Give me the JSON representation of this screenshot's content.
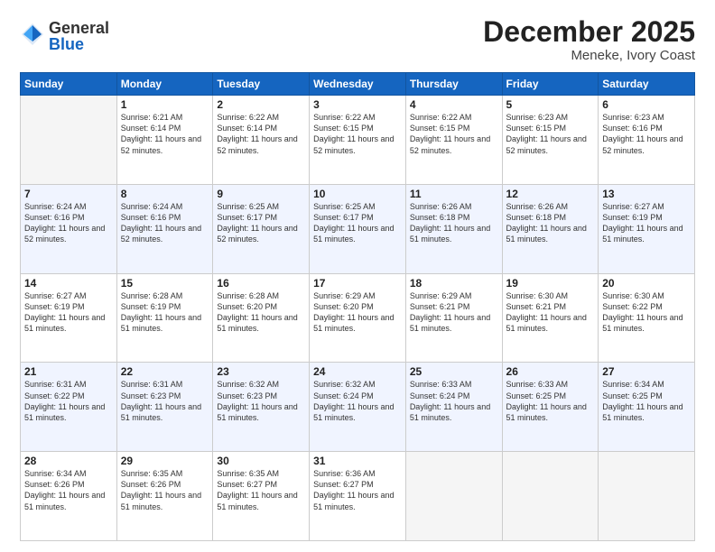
{
  "logo": {
    "general": "General",
    "blue": "Blue"
  },
  "title": "December 2025",
  "location": "Meneke, Ivory Coast",
  "days_header": [
    "Sunday",
    "Monday",
    "Tuesday",
    "Wednesday",
    "Thursday",
    "Friday",
    "Saturday"
  ],
  "weeks": [
    [
      {
        "num": "",
        "empty": true
      },
      {
        "num": "1",
        "sunrise": "Sunrise: 6:21 AM",
        "sunset": "Sunset: 6:14 PM",
        "daylight": "Daylight: 11 hours and 52 minutes."
      },
      {
        "num": "2",
        "sunrise": "Sunrise: 6:22 AM",
        "sunset": "Sunset: 6:14 PM",
        "daylight": "Daylight: 11 hours and 52 minutes."
      },
      {
        "num": "3",
        "sunrise": "Sunrise: 6:22 AM",
        "sunset": "Sunset: 6:15 PM",
        "daylight": "Daylight: 11 hours and 52 minutes."
      },
      {
        "num": "4",
        "sunrise": "Sunrise: 6:22 AM",
        "sunset": "Sunset: 6:15 PM",
        "daylight": "Daylight: 11 hours and 52 minutes."
      },
      {
        "num": "5",
        "sunrise": "Sunrise: 6:23 AM",
        "sunset": "Sunset: 6:15 PM",
        "daylight": "Daylight: 11 hours and 52 minutes."
      },
      {
        "num": "6",
        "sunrise": "Sunrise: 6:23 AM",
        "sunset": "Sunset: 6:16 PM",
        "daylight": "Daylight: 11 hours and 52 minutes."
      }
    ],
    [
      {
        "num": "7",
        "sunrise": "Sunrise: 6:24 AM",
        "sunset": "Sunset: 6:16 PM",
        "daylight": "Daylight: 11 hours and 52 minutes."
      },
      {
        "num": "8",
        "sunrise": "Sunrise: 6:24 AM",
        "sunset": "Sunset: 6:16 PM",
        "daylight": "Daylight: 11 hours and 52 minutes."
      },
      {
        "num": "9",
        "sunrise": "Sunrise: 6:25 AM",
        "sunset": "Sunset: 6:17 PM",
        "daylight": "Daylight: 11 hours and 52 minutes."
      },
      {
        "num": "10",
        "sunrise": "Sunrise: 6:25 AM",
        "sunset": "Sunset: 6:17 PM",
        "daylight": "Daylight: 11 hours and 51 minutes."
      },
      {
        "num": "11",
        "sunrise": "Sunrise: 6:26 AM",
        "sunset": "Sunset: 6:18 PM",
        "daylight": "Daylight: 11 hours and 51 minutes."
      },
      {
        "num": "12",
        "sunrise": "Sunrise: 6:26 AM",
        "sunset": "Sunset: 6:18 PM",
        "daylight": "Daylight: 11 hours and 51 minutes."
      },
      {
        "num": "13",
        "sunrise": "Sunrise: 6:27 AM",
        "sunset": "Sunset: 6:19 PM",
        "daylight": "Daylight: 11 hours and 51 minutes."
      }
    ],
    [
      {
        "num": "14",
        "sunrise": "Sunrise: 6:27 AM",
        "sunset": "Sunset: 6:19 PM",
        "daylight": "Daylight: 11 hours and 51 minutes."
      },
      {
        "num": "15",
        "sunrise": "Sunrise: 6:28 AM",
        "sunset": "Sunset: 6:19 PM",
        "daylight": "Daylight: 11 hours and 51 minutes."
      },
      {
        "num": "16",
        "sunrise": "Sunrise: 6:28 AM",
        "sunset": "Sunset: 6:20 PM",
        "daylight": "Daylight: 11 hours and 51 minutes."
      },
      {
        "num": "17",
        "sunrise": "Sunrise: 6:29 AM",
        "sunset": "Sunset: 6:20 PM",
        "daylight": "Daylight: 11 hours and 51 minutes."
      },
      {
        "num": "18",
        "sunrise": "Sunrise: 6:29 AM",
        "sunset": "Sunset: 6:21 PM",
        "daylight": "Daylight: 11 hours and 51 minutes."
      },
      {
        "num": "19",
        "sunrise": "Sunrise: 6:30 AM",
        "sunset": "Sunset: 6:21 PM",
        "daylight": "Daylight: 11 hours and 51 minutes."
      },
      {
        "num": "20",
        "sunrise": "Sunrise: 6:30 AM",
        "sunset": "Sunset: 6:22 PM",
        "daylight": "Daylight: 11 hours and 51 minutes."
      }
    ],
    [
      {
        "num": "21",
        "sunrise": "Sunrise: 6:31 AM",
        "sunset": "Sunset: 6:22 PM",
        "daylight": "Daylight: 11 hours and 51 minutes."
      },
      {
        "num": "22",
        "sunrise": "Sunrise: 6:31 AM",
        "sunset": "Sunset: 6:23 PM",
        "daylight": "Daylight: 11 hours and 51 minutes."
      },
      {
        "num": "23",
        "sunrise": "Sunrise: 6:32 AM",
        "sunset": "Sunset: 6:23 PM",
        "daylight": "Daylight: 11 hours and 51 minutes."
      },
      {
        "num": "24",
        "sunrise": "Sunrise: 6:32 AM",
        "sunset": "Sunset: 6:24 PM",
        "daylight": "Daylight: 11 hours and 51 minutes."
      },
      {
        "num": "25",
        "sunrise": "Sunrise: 6:33 AM",
        "sunset": "Sunset: 6:24 PM",
        "daylight": "Daylight: 11 hours and 51 minutes."
      },
      {
        "num": "26",
        "sunrise": "Sunrise: 6:33 AM",
        "sunset": "Sunset: 6:25 PM",
        "daylight": "Daylight: 11 hours and 51 minutes."
      },
      {
        "num": "27",
        "sunrise": "Sunrise: 6:34 AM",
        "sunset": "Sunset: 6:25 PM",
        "daylight": "Daylight: 11 hours and 51 minutes."
      }
    ],
    [
      {
        "num": "28",
        "sunrise": "Sunrise: 6:34 AM",
        "sunset": "Sunset: 6:26 PM",
        "daylight": "Daylight: 11 hours and 51 minutes."
      },
      {
        "num": "29",
        "sunrise": "Sunrise: 6:35 AM",
        "sunset": "Sunset: 6:26 PM",
        "daylight": "Daylight: 11 hours and 51 minutes."
      },
      {
        "num": "30",
        "sunrise": "Sunrise: 6:35 AM",
        "sunset": "Sunset: 6:27 PM",
        "daylight": "Daylight: 11 hours and 51 minutes."
      },
      {
        "num": "31",
        "sunrise": "Sunrise: 6:36 AM",
        "sunset": "Sunset: 6:27 PM",
        "daylight": "Daylight: 11 hours and 51 minutes."
      },
      {
        "num": "",
        "empty": true
      },
      {
        "num": "",
        "empty": true
      },
      {
        "num": "",
        "empty": true
      }
    ]
  ]
}
